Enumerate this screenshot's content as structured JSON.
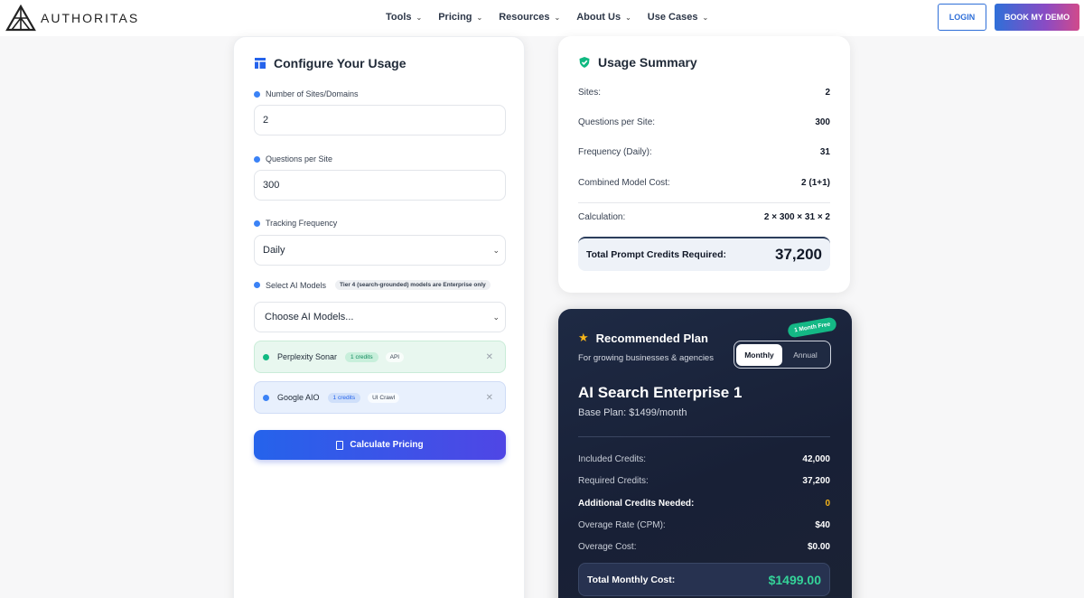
{
  "nav": {
    "logo_text": "AUTHORITAS",
    "menu": [
      {
        "label": "Tools"
      },
      {
        "label": "Pricing"
      },
      {
        "label": "Resources"
      },
      {
        "label": "About Us"
      },
      {
        "label": "Use Cases"
      }
    ],
    "login_label": "LOGIN",
    "demo_label": "BOOK MY DEMO"
  },
  "config": {
    "title": "Configure Your Usage",
    "sites_label": "Number of Sites/Domains",
    "sites_value": "2",
    "questions_label": "Questions per Site",
    "questions_value": "300",
    "frequency_label": "Tracking Frequency",
    "frequency_value": "Daily",
    "models_label": "Select AI Models",
    "models_note": "Tier 4 (search-grounded) models are Enterprise only",
    "models_placeholder": "Choose AI Models...",
    "models": [
      {
        "name": "Perplexity Sonar",
        "credits": "1 credits",
        "tag": "API",
        "color": "#10b981"
      },
      {
        "name": "Google AIO",
        "credits": "1 credits",
        "tag": "UI Crawl",
        "color": "#3b82f6"
      }
    ],
    "calculate_label": "Calculate Pricing"
  },
  "summary": {
    "title": "Usage Summary",
    "rows": [
      {
        "label": "Sites:",
        "value": "2"
      },
      {
        "label": "Questions per Site:",
        "value": "300"
      },
      {
        "label": "Frequency (Daily):",
        "value": "31"
      },
      {
        "label": "Combined Model Cost:",
        "value": "2 (1+1)"
      }
    ],
    "calc_label": "Calculation:",
    "calc_value": "2 × 300 × 31 × 2",
    "total_label": "Total Prompt Credits Required:",
    "total_value": "37,200"
  },
  "plan": {
    "badge": "1 Month Free",
    "title": "Recommended Plan",
    "subtitle": "For growing businesses & agencies",
    "toggle_monthly": "Monthly",
    "toggle_annual": "Annual",
    "name": "AI Search Enterprise 1",
    "base": "Base Plan: $1499/month",
    "rows": [
      {
        "label": "Included Credits:",
        "value": "42,000"
      },
      {
        "label": "Required Credits:",
        "value": "37,200"
      },
      {
        "label": "Additional Credits Needed:",
        "value": "0"
      },
      {
        "label": "Overage Rate (CPM):",
        "value": "$40"
      },
      {
        "label": "Overage Cost:",
        "value": "$0.00"
      }
    ],
    "total_label": "Total Monthly Cost:",
    "total_value": "$1499.00",
    "colors": {
      "accent_green": "#34d399",
      "warning": "#f5b419"
    }
  }
}
